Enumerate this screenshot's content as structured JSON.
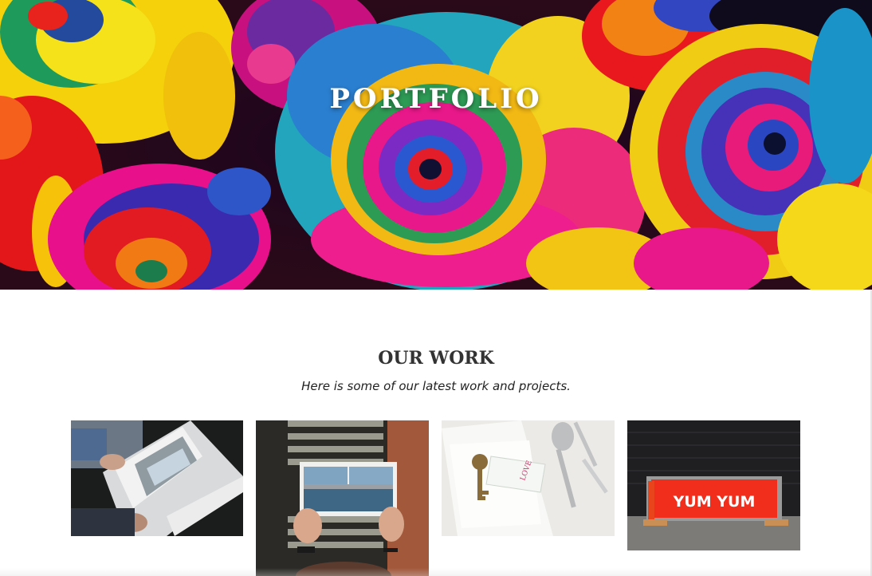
{
  "hero": {
    "title": "PORTFOLIO",
    "image": "rainbow-roses"
  },
  "work": {
    "heading": "OUR WORK",
    "subheading": "Here is some of our latest work and projects.",
    "items": [
      {
        "image": "person-reading-architecture-book"
      },
      {
        "image": "hands-holding-city-photo-book-on-stairs"
      },
      {
        "image": "table-setting-with-vintage-key-and-love-tag",
        "tag_text": "LOVE"
      },
      {
        "image": "red-yum-yum-sign",
        "sign_text": "YUM YUM"
      }
    ]
  }
}
